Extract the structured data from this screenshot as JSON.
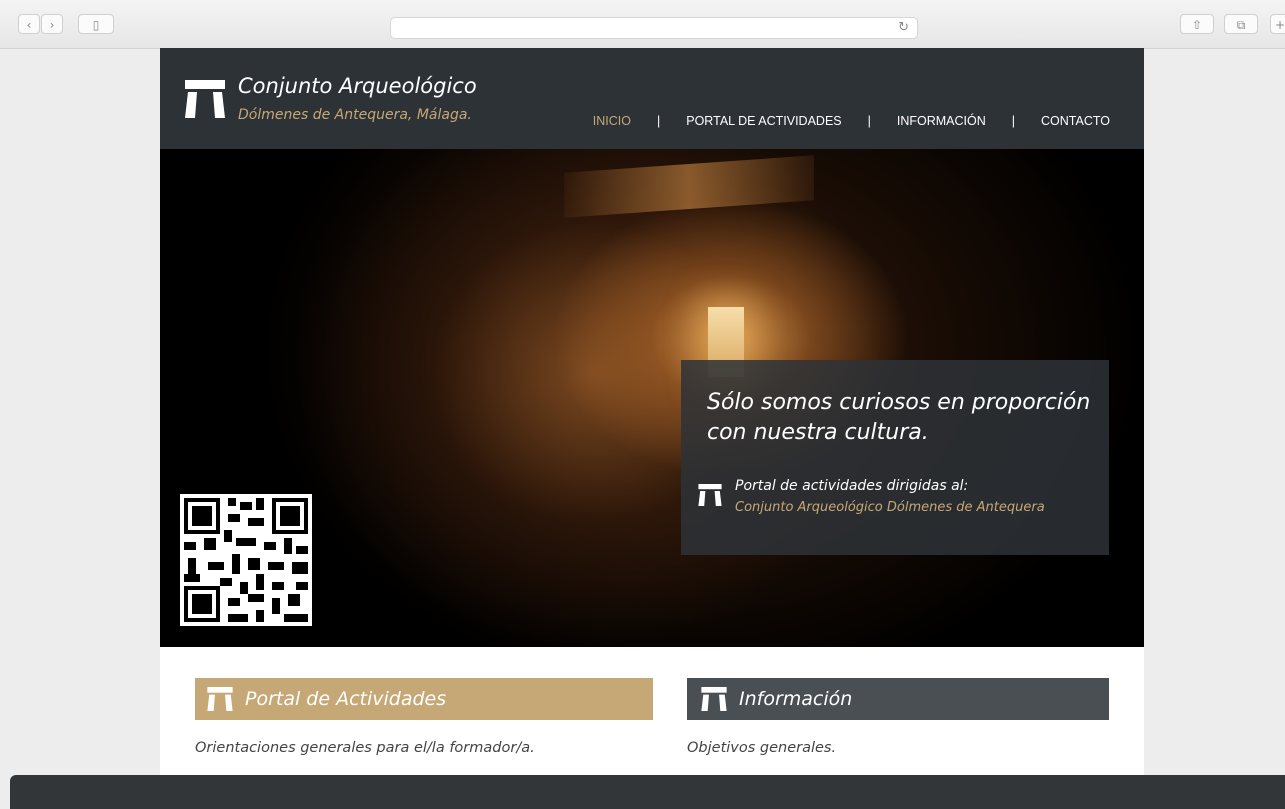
{
  "brand": {
    "title": "Conjunto Arqueológico",
    "subtitle": "Dólmenes de Antequera, Málaga."
  },
  "nav": [
    {
      "label": "INICIO",
      "active": true
    },
    {
      "label": "PORTAL DE ACTIVIDADES",
      "active": false
    },
    {
      "label": "INFORMACIÓN",
      "active": false
    },
    {
      "label": "CONTACTO",
      "active": false
    }
  ],
  "nav_separator": "|",
  "hero": {
    "quote": "Sólo somos curiosos en proporción con nuestra cultura.",
    "line1": "Portal de actividades dirigidas al:",
    "line2": "Conjunto Arqueológico Dólmenes de Antequera"
  },
  "sections": [
    {
      "title": "Portal de Actividades",
      "text": "Orientaciones generales para el/la formador/a.",
      "color": "#c6a877"
    },
    {
      "title": "Información",
      "text": "Objetivos generales.",
      "color": "#4a4f53"
    }
  ],
  "colors": {
    "header": "#2d3237",
    "accent": "#c6a877",
    "footer": "#333638"
  },
  "icons": {
    "back": "‹",
    "forward": "›",
    "sidebar": "▯",
    "reload": "↻",
    "share": "⇧",
    "tabs": "⧉",
    "new_tab": "+"
  }
}
